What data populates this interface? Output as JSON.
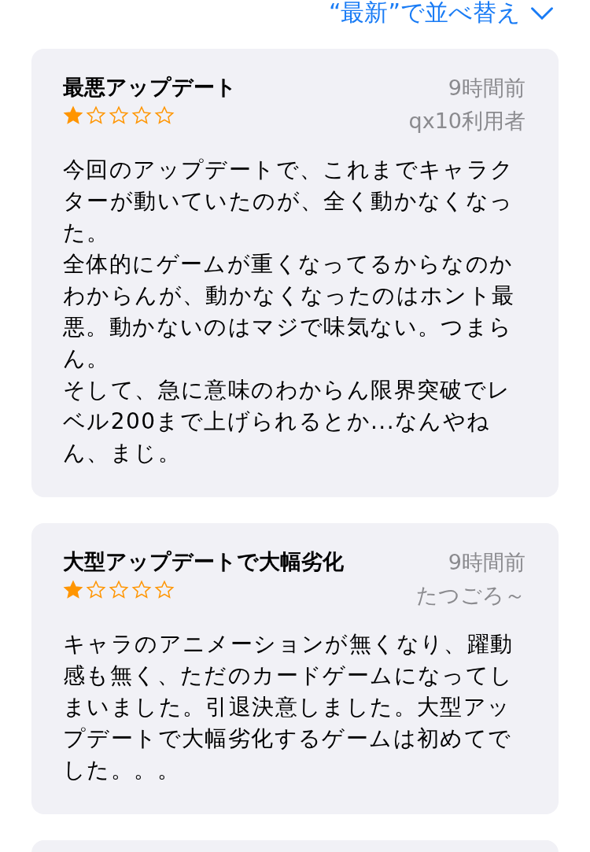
{
  "sort_button": {
    "label": "“最新”で並べ替え"
  },
  "reviews": [
    {
      "title": "最悪アップデート",
      "time": "9時間前",
      "author": "qx10利用者",
      "stars": 1,
      "body": [
        "今回のアップデートで、これまでキャラクターが動いていたのが、全く動かなくなった。",
        "全体的にゲームが重くなってるからなのかわからんが、動かなくなったのはホント最悪。動かないのはマジで味気ない。つまらん。",
        "そして、急に意味のわからん限界突破でレベル200まで上げられるとか...なんやねん、まじ。"
      ]
    },
    {
      "title": "大型アップデートで大幅劣化",
      "time": "9時間前",
      "author": "たつごろ～",
      "stars": 1,
      "body": [
        "キャラのアニメーションが無くなり、躍動感も無く、ただのカードゲームになってしまいました。引退決意しました。大型アップデートで大幅劣化するゲームは初めてでした。。。"
      ]
    }
  ]
}
